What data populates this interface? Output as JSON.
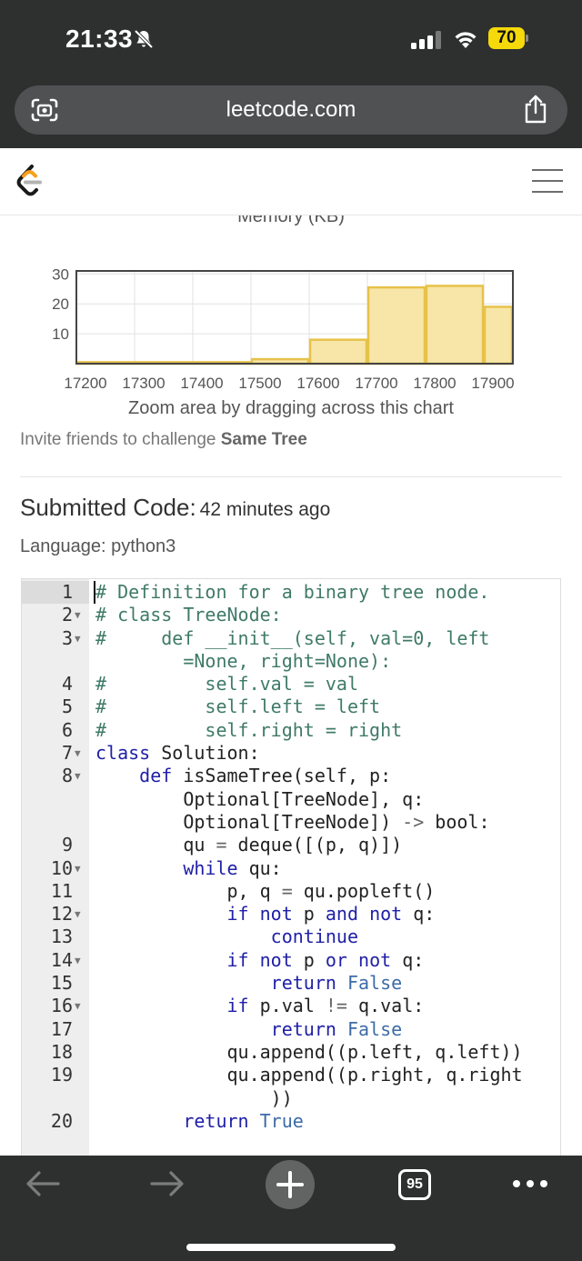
{
  "status": {
    "time": "21:33",
    "battery": "70"
  },
  "browser": {
    "url": "leetcode.com",
    "open_tabs": "95"
  },
  "chart_data": {
    "type": "bar",
    "title": "Memory (KB)",
    "x": [
      17200,
      17300,
      17400,
      17500,
      17600,
      17700,
      17800,
      17900
    ],
    "x_tick_labels": [
      "17200",
      "17300",
      "17400",
      "17500",
      "17600",
      "17700",
      "17800",
      "17900"
    ],
    "y_tick_labels": [
      "10",
      "20",
      "30"
    ],
    "bins": [
      {
        "start": 17200,
        "end": 17300,
        "value": 0.5
      },
      {
        "start": 17300,
        "end": 17400,
        "value": 0.5
      },
      {
        "start": 17400,
        "end": 17500,
        "value": 0.5
      },
      {
        "start": 17500,
        "end": 17600,
        "value": 1.5
      },
      {
        "start": 17600,
        "end": 17700,
        "value": 8
      },
      {
        "start": 17700,
        "end": 17800,
        "value": 25.5
      },
      {
        "start": 17800,
        "end": 17900,
        "value": 26
      },
      {
        "start": 17900,
        "end": 17950,
        "value": 19
      }
    ],
    "xlim": [
      17200,
      17950
    ],
    "ylim": [
      0,
      31
    ],
    "grid": true,
    "bar_fill": "#f7e6a8",
    "bar_stroke": "#e7c24a"
  },
  "chart_hint": "Zoom area by dragging across this chart",
  "invite": {
    "prefix": "Invite friends to challenge ",
    "problem": "Same Tree"
  },
  "submission": {
    "heading": "Submitted Code:",
    "time_ago": "42 minutes ago",
    "language": "Language: python3"
  },
  "code_lines": [
    {
      "n": "1",
      "fold": false,
      "html": "<span class=\"cm\"># Definition for a binary tree node.</span>"
    },
    {
      "n": "2",
      "fold": true,
      "html": "<span class=\"cm\"># class TreeNode:</span>"
    },
    {
      "n": "3",
      "fold": true,
      "html": "<span class=\"cm\">#     def __init__(self, val=0, left</span>"
    },
    {
      "n": "",
      "fold": false,
      "html": "<span class=\"cm\">        =None, right=None):</span>"
    },
    {
      "n": "4",
      "fold": false,
      "html": "<span class=\"cm\">#         self.val = val</span>"
    },
    {
      "n": "5",
      "fold": false,
      "html": "<span class=\"cm\">#         self.left = left</span>"
    },
    {
      "n": "6",
      "fold": false,
      "html": "<span class=\"cm\">#         self.right = right</span>"
    },
    {
      "n": "7",
      "fold": true,
      "html": "<span class=\"kw\">class</span> Solution:"
    },
    {
      "n": "8",
      "fold": true,
      "html": "    <span class=\"kw\">def</span> isSameTree(self, p:"
    },
    {
      "n": "",
      "fold": false,
      "html": "        Optional[TreeNode], q:"
    },
    {
      "n": "",
      "fold": false,
      "html": "        Optional[TreeNode]) <span class=\"op\">-&gt;</span> bool:"
    },
    {
      "n": "9",
      "fold": false,
      "html": "        qu <span class=\"op\">=</span> deque([(p, q)])"
    },
    {
      "n": "10",
      "fold": true,
      "html": "        <span class=\"kw\">while</span> qu:"
    },
    {
      "n": "11",
      "fold": false,
      "html": "            p, q <span class=\"op\">=</span> qu.popleft()"
    },
    {
      "n": "12",
      "fold": true,
      "html": "            <span class=\"kw\">if</span> <span class=\"kw\">not</span> p <span class=\"kw\">and</span> <span class=\"kw\">not</span> q:"
    },
    {
      "n": "13",
      "fold": false,
      "html": "                <span class=\"kw\">continue</span>"
    },
    {
      "n": "14",
      "fold": true,
      "html": "            <span class=\"kw\">if</span> <span class=\"kw\">not</span> p <span class=\"kw\">or</span> <span class=\"kw\">not</span> q:"
    },
    {
      "n": "15",
      "fold": false,
      "html": "                <span class=\"kw\">return</span> <span class=\"con\">False</span>"
    },
    {
      "n": "16",
      "fold": true,
      "html": "            <span class=\"kw\">if</span> p.val <span class=\"op\">!=</span> q.val:"
    },
    {
      "n": "17",
      "fold": false,
      "html": "                <span class=\"kw\">return</span> <span class=\"con\">False</span>"
    },
    {
      "n": "18",
      "fold": false,
      "html": "            qu.append((p.left, q.left))"
    },
    {
      "n": "19",
      "fold": false,
      "html": "            qu.append((p.right, q.right"
    },
    {
      "n": "",
      "fold": false,
      "html": "                ))"
    },
    {
      "n": "20",
      "fold": false,
      "html": "        <span class=\"kw\">return</span> <span class=\"con\">True</span>"
    }
  ]
}
